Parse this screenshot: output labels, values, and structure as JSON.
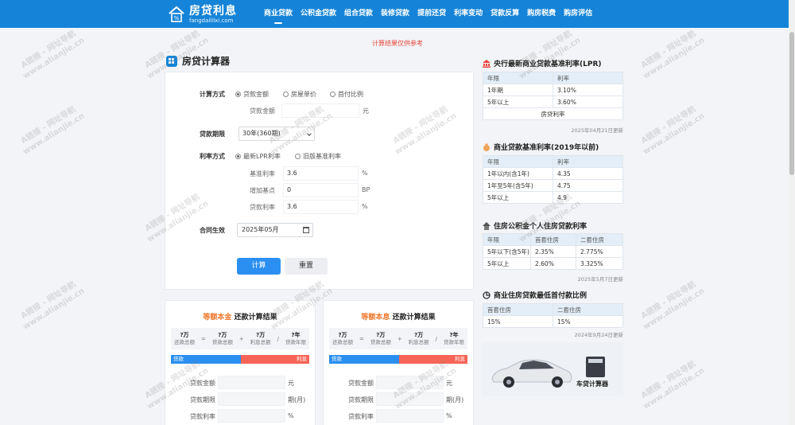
{
  "header": {
    "logo_name": "房贷利息",
    "logo_domain": "fangdaililxi.com",
    "nav": [
      "商业贷款",
      "公积金贷款",
      "组合贷款",
      "装修贷款",
      "提前还贷",
      "利率变动",
      "贷款反算",
      "购房税费",
      "购房评估"
    ]
  },
  "notice": "计算结果仅供参考",
  "calculator": {
    "title": "房贷计算器",
    "method_label": "计算方式",
    "method_options": [
      "贷款金额",
      "房屋单价",
      "首付比例"
    ],
    "loan_amount_label": "贷款金额",
    "loan_amount_unit": "元",
    "term_label": "贷款期限",
    "term_value": "30年(360期)",
    "rate_method_label": "利率方式",
    "rate_method_options": [
      "最新LPR利率",
      "旧版基准利率"
    ],
    "base_rate_label": "基准利率",
    "base_rate_value": "3.6",
    "base_rate_unit": "%",
    "add_points_label": "增加基点",
    "add_points_value": "0",
    "add_points_unit": "BP",
    "loan_rate_label": "贷款利率",
    "loan_rate_value": "3.6",
    "loan_rate_unit": "%",
    "effective_label": "合同生效",
    "effective_value": "2025年05月",
    "calc_button": "计算",
    "reset_button": "重置"
  },
  "results": [
    {
      "title_hl": "等额本金",
      "title_rest": "还款计算结果",
      "summary": [
        {
          "value": "?万",
          "label": "还款总额"
        },
        {
          "value": "?万",
          "label": "贷款总额"
        },
        {
          "value": "?万",
          "label": "利息总额"
        },
        {
          "value": "?年",
          "label": "贷款年限"
        }
      ],
      "ops": [
        "=",
        "+",
        "/"
      ],
      "bar_a": "贷款",
      "bar_b": "利息",
      "rows": [
        {
          "label": "贷款金额",
          "unit": "元"
        },
        {
          "label": "贷款期限",
          "unit": "期(月)"
        },
        {
          "label": "贷款利率",
          "unit": "%"
        }
      ]
    },
    {
      "title_hl": "等额本息",
      "title_rest": "还款计算结果",
      "summary": [
        {
          "value": "?万",
          "label": "还款总额"
        },
        {
          "value": "?万",
          "label": "贷款总额"
        },
        {
          "value": "?万",
          "label": "利息总额"
        },
        {
          "value": "?年",
          "label": "贷款年限"
        }
      ],
      "ops": [
        "=",
        "+",
        "/"
      ],
      "bar_a": "贷款",
      "bar_b": "利息",
      "rows": [
        {
          "label": "贷款金额",
          "unit": "元"
        },
        {
          "label": "贷款期限",
          "unit": "期(月)"
        },
        {
          "label": "贷款利率",
          "unit": "%"
        }
      ]
    }
  ],
  "sidebar": {
    "lpr": {
      "title": "央行最新商业贷款基准利率(LPR)",
      "headers": [
        "年限",
        "利率"
      ],
      "rows": [
        [
          "1年期",
          "3.10%"
        ],
        [
          "5年以上",
          "3.60%"
        ]
      ],
      "footer": "房贷利率",
      "note": "2025年04月21日更新"
    },
    "base": {
      "title": "商业贷款基准利率(2019年以前)",
      "headers": [
        "年限",
        "利率"
      ],
      "rows": [
        [
          "1年以内(含1年)",
          "4.35"
        ],
        [
          "1年至5年(含5年)",
          "4.75"
        ],
        [
          "5年以上",
          "4.9"
        ]
      ]
    },
    "fund": {
      "title": "住房公积金个人住房贷款利率",
      "headers": [
        "年限",
        "首套住房",
        "二套住房"
      ],
      "rows": [
        [
          "5年以下(含5年)",
          "2.35%",
          "2.775%"
        ],
        [
          "5年以上",
          "2.60%",
          "3.325%"
        ]
      ],
      "note": "2025年5月7日更新"
    },
    "down": {
      "title": "商业住房贷款最低首付款比例",
      "headers": [
        "首套住房",
        "二套住房"
      ],
      "rows": [
        [
          "15%",
          "15%"
        ]
      ],
      "note": "2024年9月24日更新"
    },
    "promo_label": "车贷计算器"
  },
  "watermark": {
    "line1": "A链接 - 网址导航",
    "line2": "www.alianjie.cn"
  },
  "colors": {
    "brand": "#1584d8",
    "primary_button": "#2a8ff0",
    "loan_bar": "#2a8ff0",
    "interest_bar": "#f66555",
    "highlight": "#f0782d",
    "notice": "#e8453c"
  }
}
